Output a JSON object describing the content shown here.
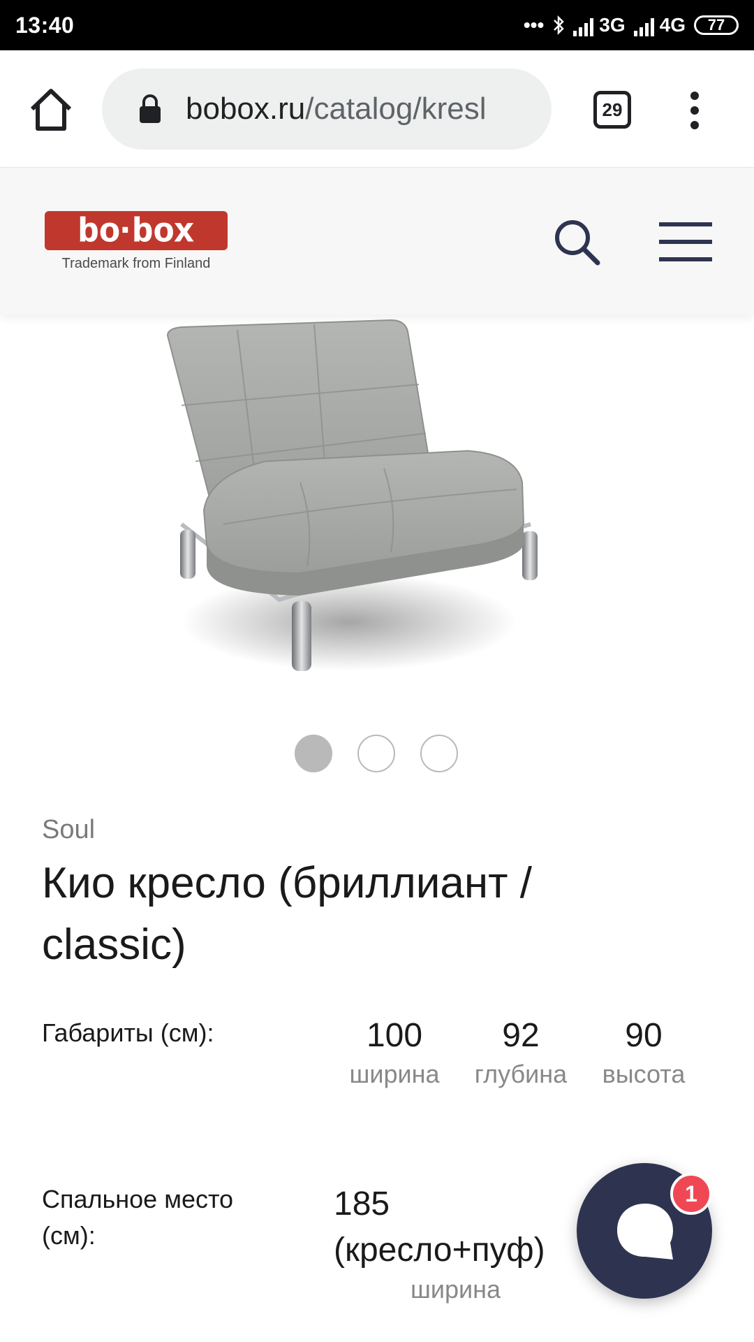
{
  "status_bar": {
    "time": "13:40",
    "network_1": "3G",
    "network_2": "4G",
    "battery": "77"
  },
  "browser": {
    "url_host": "bobox.ru",
    "url_path": "/catalog/kresl",
    "tab_count": "29",
    "icons": [
      "home-icon",
      "lock-icon",
      "tabs-icon",
      "more-vert-icon"
    ]
  },
  "site": {
    "logo_text": "bo·box",
    "logo_tagline": "Trademark from Finland",
    "brand_color": "#c0382d",
    "icons": [
      "search-icon",
      "hamburger-menu-icon"
    ]
  },
  "carousel": {
    "slides": 3,
    "active_index": 0
  },
  "product": {
    "brand": "Soul",
    "title": "Кио кресло (бриллиант / classic)",
    "dimensions_label": "Габариты (см):",
    "dimensions": [
      {
        "value": "100",
        "unit": "ширина"
      },
      {
        "value": "92",
        "unit": "глубина"
      },
      {
        "value": "90",
        "unit": "высота"
      }
    ],
    "sleeping_label": "Спальное место (см):",
    "sleeping_value_line1": "185",
    "sleeping_value_line2": "(кресло+пуф)",
    "sleeping_unit": "ширина"
  },
  "chat": {
    "badge_count": "1",
    "color": "#2e3450",
    "badge_color": "#ef4854"
  }
}
